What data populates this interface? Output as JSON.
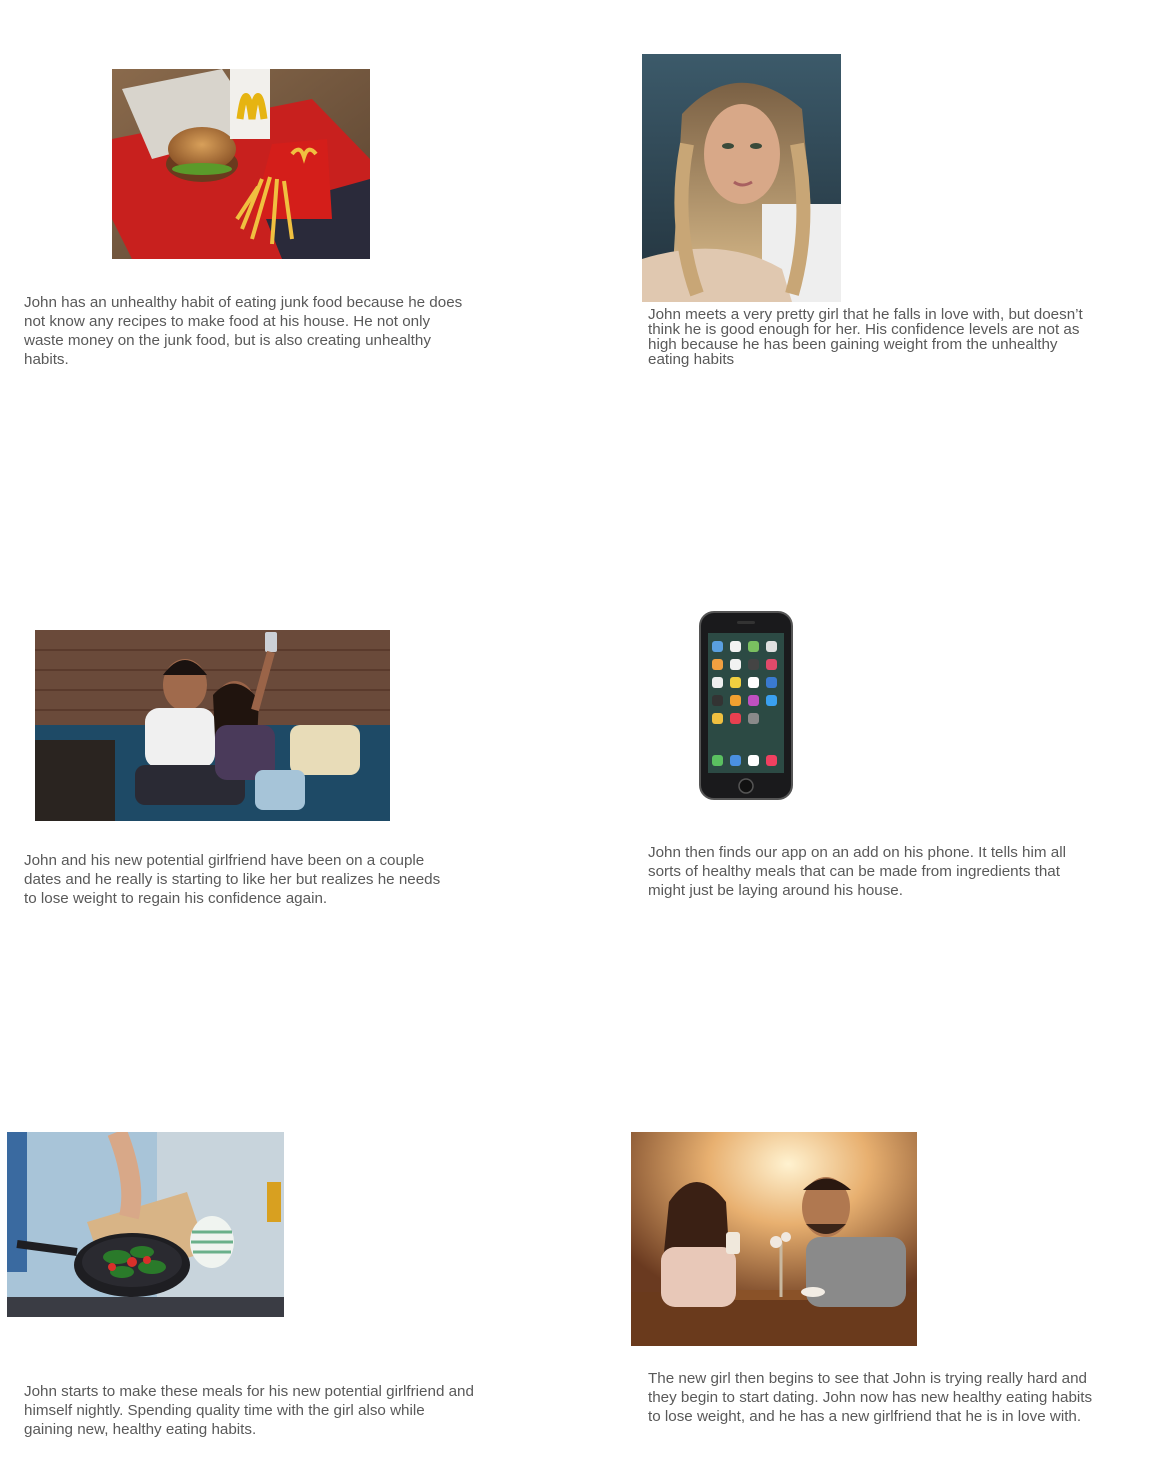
{
  "panels": [
    {
      "id": "junk-food",
      "image": "mcdonalds-burger-and-fries-photo",
      "caption": "John has an unhealthy habit of eating junk food because he does not know any recipes to make food at his house. He not only waste money on the junk food, but is also creating unhealthy habits."
    },
    {
      "id": "pretty-girl",
      "image": "blonde-woman-portrait-photo",
      "caption": "John meets a very pretty girl that he falls in love with, but doesn’t think he is good enough for her. His confidence levels are not as high because he has been gaining weight from the unhealthy eating habits"
    },
    {
      "id": "couple-dates",
      "image": "couple-selfie-on-couch-photo",
      "caption": "John and his new potential girlfriend have been on a couple dates and he really is starting to like her but realizes he needs to lose weight to regain his confidence again."
    },
    {
      "id": "app-ad",
      "image": "smartphone-home-screen-photo",
      "caption": "John then finds our app on an add on his phone. It tells him all sorts of healthy meals that can be made from ingredients that might just be laying around his house."
    },
    {
      "id": "cooking",
      "image": "cooking-vegetables-in-pan-photo",
      "caption": "John starts to make these meals for his new potential girlfriend and himself nightly. Spending quality time with the girl also while gaining new, healthy eating habits."
    },
    {
      "id": "dating",
      "image": "couple-date-at-cafe-photo",
      "caption": "The new girl then begins to see that John is trying really hard and they begin to start dating. John now has new healthy eating habits to lose weight, and he has a new girlfriend that he is in love with."
    }
  ]
}
